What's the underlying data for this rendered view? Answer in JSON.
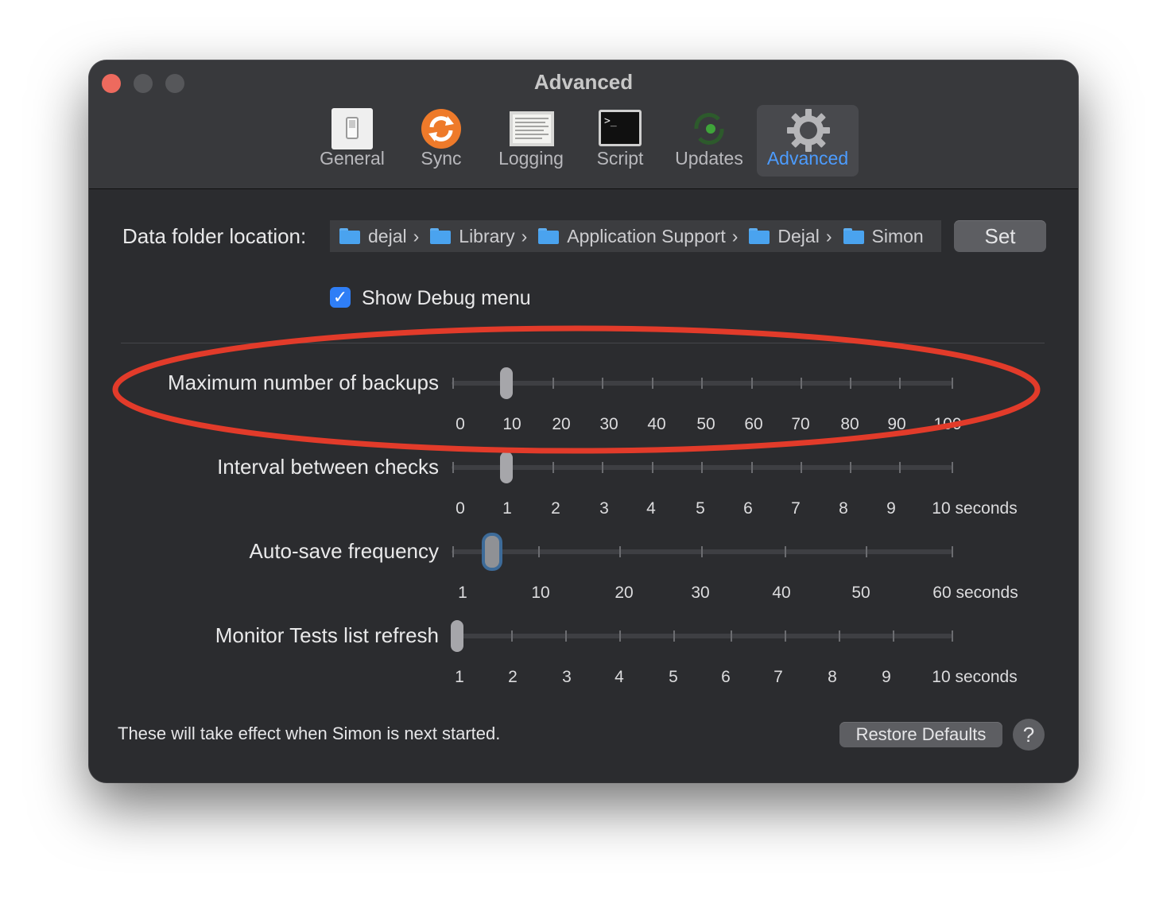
{
  "window": {
    "title": "Advanced"
  },
  "toolbar": {
    "tabs": [
      {
        "label": "General",
        "icon": "switch-icon"
      },
      {
        "label": "Sync",
        "icon": "sync-icon"
      },
      {
        "label": "Logging",
        "icon": "log-icon"
      },
      {
        "label": "Script",
        "icon": "terminal-icon"
      },
      {
        "label": "Updates",
        "icon": "updates-icon"
      },
      {
        "label": "Advanced",
        "icon": "gear-icon",
        "active": true
      }
    ]
  },
  "data_folder": {
    "label": "Data folder location:",
    "path": [
      "dejal",
      "Library",
      "Application Support",
      "Dejal",
      "Simon"
    ],
    "set_label": "Set"
  },
  "debug": {
    "label": "Show Debug menu",
    "checked": true
  },
  "sliders": [
    {
      "label": "Maximum number of backups",
      "ticks": [
        "0",
        "10",
        "20",
        "30",
        "40",
        "50",
        "60",
        "70",
        "80",
        "90",
        "100"
      ],
      "value": 10
    },
    {
      "label": "Interval between checks",
      "ticks": [
        "0",
        "1",
        "2",
        "3",
        "4",
        "5",
        "6",
        "7",
        "8",
        "9",
        "10 seconds"
      ],
      "value": 1
    },
    {
      "label": "Auto-save frequency",
      "ticks": [
        "1",
        "10",
        "20",
        "30",
        "40",
        "50",
        "60 seconds"
      ],
      "value": 5
    },
    {
      "label": "Monitor Tests list refresh",
      "ticks": [
        "1",
        "2",
        "3",
        "4",
        "5",
        "6",
        "7",
        "8",
        "9",
        "10 seconds"
      ],
      "value": 1
    }
  ],
  "footer": {
    "note": "These will take effect when Simon is next started.",
    "restore_label": "Restore Defaults",
    "help_label": "?"
  },
  "colors": {
    "accent": "#4c9cff",
    "highlight": "#e23b2a",
    "checkbox": "#2f7ef6"
  }
}
